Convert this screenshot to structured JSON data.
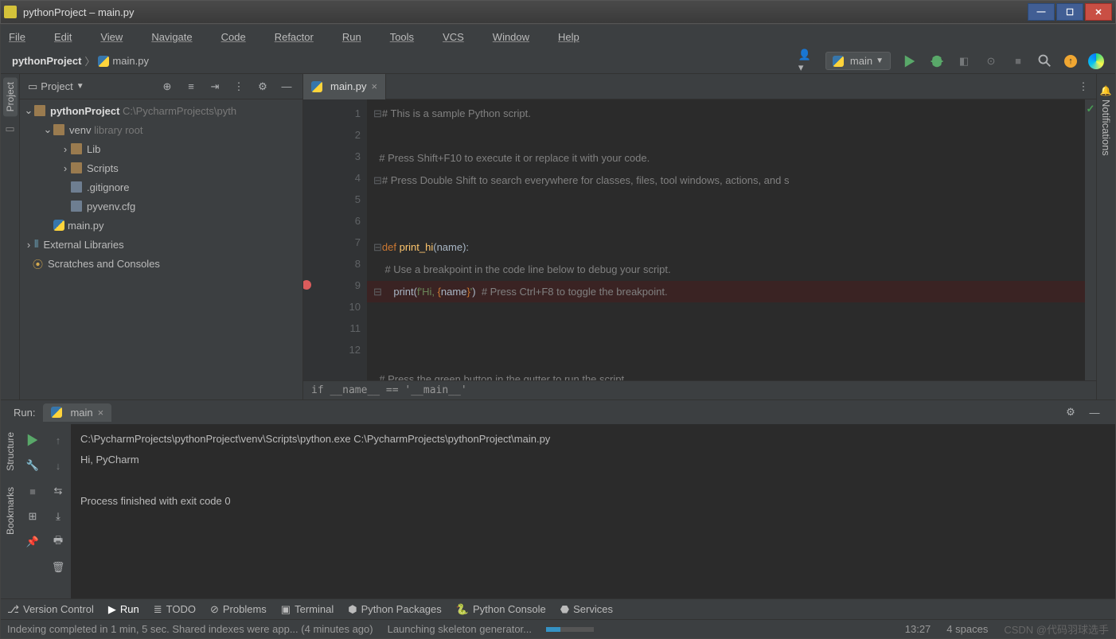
{
  "window": {
    "title": "pythonProject – main.py"
  },
  "menubar": [
    "File",
    "Edit",
    "View",
    "Navigate",
    "Code",
    "Refactor",
    "Run",
    "Tools",
    "VCS",
    "Window",
    "Help"
  ],
  "breadcrumb": {
    "project": "pythonProject",
    "file": "main.py"
  },
  "runconfig": {
    "name": "main"
  },
  "project_panel": {
    "title": "Project",
    "tree": {
      "root": "pythonProject",
      "root_path": "C:\\PycharmProjects\\pyth",
      "venv": "venv",
      "venv_note": "library root",
      "lib": "Lib",
      "scripts": "Scripts",
      "gitignore": ".gitignore",
      "pyvenv": "pyvenv.cfg",
      "main": "main.py",
      "ext": "External Libraries",
      "scratch": "Scratches and Consoles"
    }
  },
  "left_tabs": {
    "project": "Project",
    "structure": "Structure",
    "bookmarks": "Bookmarks"
  },
  "right_tabs": {
    "notifications": "Notifications"
  },
  "editor": {
    "tab": "main.py",
    "lines": [
      "1",
      "2",
      "3",
      "4",
      "5",
      "6",
      "7",
      "8",
      "9",
      "10",
      "11",
      "12"
    ],
    "breadline": "if __name__ == '__main__'",
    "code": {
      "l1": "# This is a sample Python script.",
      "l3": "# Press Shift+F10 to execute it or replace it with your code.",
      "l4": "# Press Double Shift to search everywhere for classes, files, tool windows, actions, and s",
      "l7_def": "def ",
      "l7_fn": "print_hi",
      "l7_rest": "(name):",
      "l8": "    # Use a breakpoint in the code line below to debug your script.",
      "l9_print": "    print(",
      "l9_f": "f'Hi, ",
      "l9_tm1": "{",
      "l9_name": "name",
      "l9_tm2": "}",
      "l9_end": "'",
      "l9_paren": ")  ",
      "l9_c": "# Press Ctrl+F8 to toggle the breakpoint.",
      "l12": "# Press the green button in the gutter to run the script."
    }
  },
  "run": {
    "label": "Run:",
    "tab": "main",
    "console_l1": "C:\\PycharmProjects\\pythonProject\\venv\\Scripts\\python.exe C:\\PycharmProjects\\pythonProject\\main.py",
    "console_l2": "Hi, PyCharm",
    "console_l4": "Process finished with exit code 0"
  },
  "bottom_tabs": {
    "vc": "Version Control",
    "run": "Run",
    "todo": "TODO",
    "problems": "Problems",
    "terminal": "Terminal",
    "pypkg": "Python Packages",
    "pycon": "Python Console",
    "svc": "Services"
  },
  "statusbar": {
    "indexing": "Indexing completed in 1 min, 5 sec. Shared indexes were app... (4 minutes ago)",
    "launching": "Launching skeleton generator...",
    "time": "13:27",
    "spaces": "4 spaces",
    "watermark": "CSDN @代码羽球选手"
  }
}
